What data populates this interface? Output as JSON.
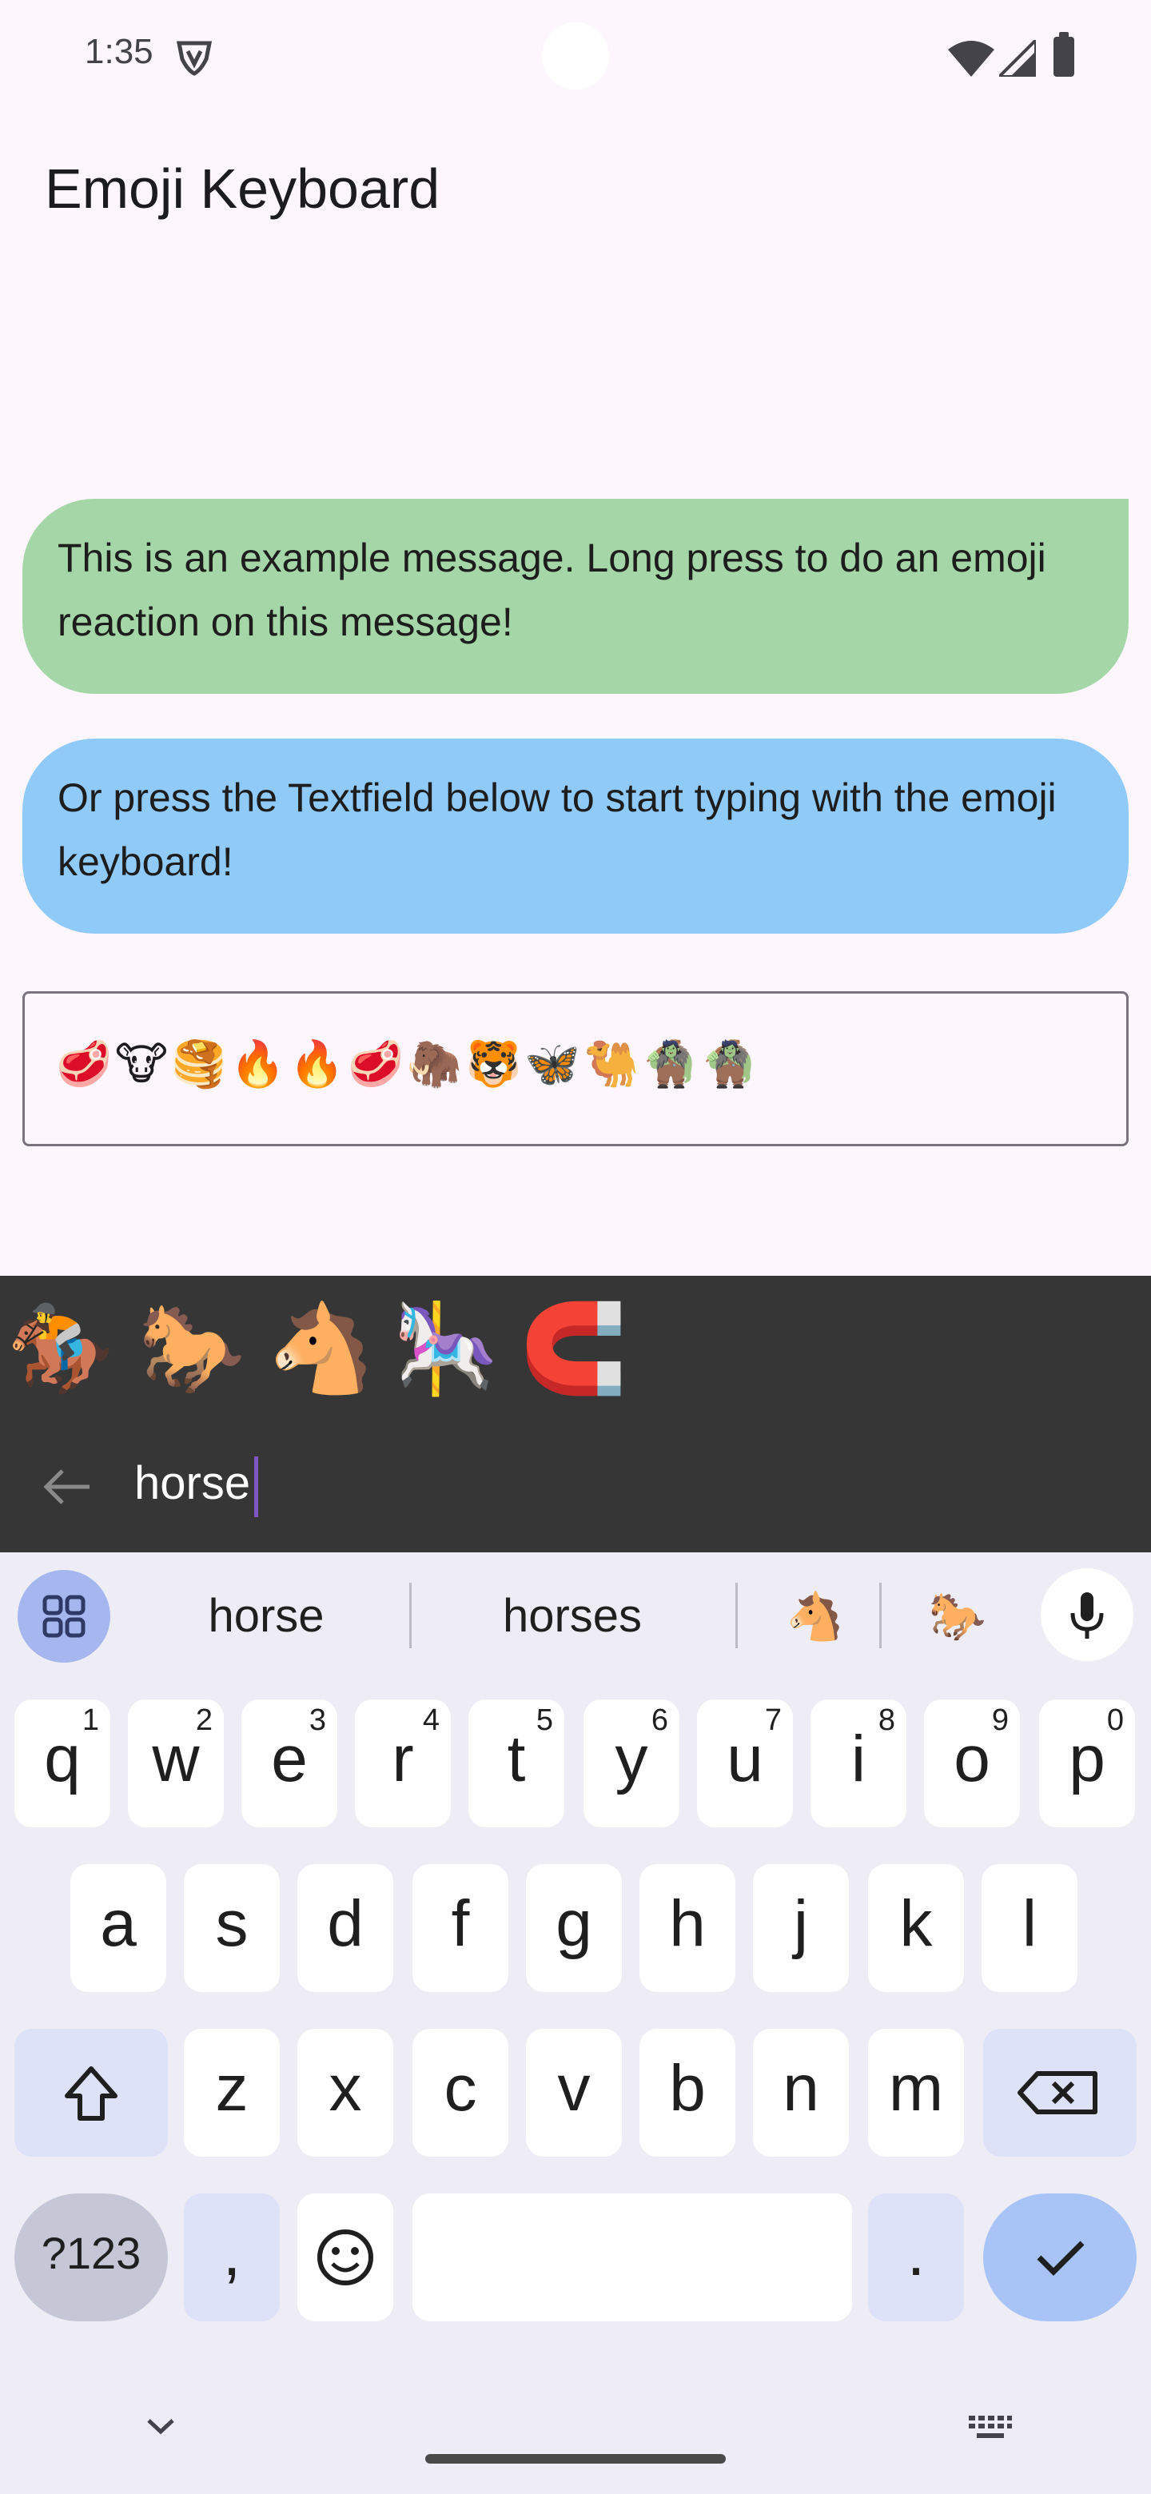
{
  "status_bar": {
    "time": "1:35"
  },
  "app": {
    "title": "Emoji Keyboard"
  },
  "messages": [
    "This is an example message. Long press to do an emoji reaction on this message!",
    "Or press the Textfield below to start typing with the emoji keyboard!"
  ],
  "textfield": {
    "value": "🥩🐮🥞🔥🔥🥩🦣🐯🦋🐫🧌🧌"
  },
  "emoji_search": {
    "results": [
      "🏇",
      "🐎",
      "🐴",
      "🎠",
      "🧲"
    ],
    "query": "horse"
  },
  "keyboard": {
    "suggestions": [
      "horse",
      "horses",
      "🐴",
      "🐎"
    ],
    "row1": [
      {
        "k": "q",
        "h": "1"
      },
      {
        "k": "w",
        "h": "2"
      },
      {
        "k": "e",
        "h": "3"
      },
      {
        "k": "r",
        "h": "4"
      },
      {
        "k": "t",
        "h": "5"
      },
      {
        "k": "y",
        "h": "6"
      },
      {
        "k": "u",
        "h": "7"
      },
      {
        "k": "i",
        "h": "8"
      },
      {
        "k": "o",
        "h": "9"
      },
      {
        "k": "p",
        "h": "0"
      }
    ],
    "row2": [
      "a",
      "s",
      "d",
      "f",
      "g",
      "h",
      "j",
      "k",
      "l"
    ],
    "row3": [
      "z",
      "x",
      "c",
      "v",
      "b",
      "n",
      "m"
    ],
    "symbols_label": "?123",
    "comma": ",",
    "period": "."
  },
  "colors": {
    "background": "#fdf7fd",
    "bubble_green": "#a5d6a7",
    "bubble_blue": "#90caf9",
    "panel_dark": "#363636",
    "keyboard_bg": "#eeedf5",
    "accent": "#a8c3f6"
  }
}
